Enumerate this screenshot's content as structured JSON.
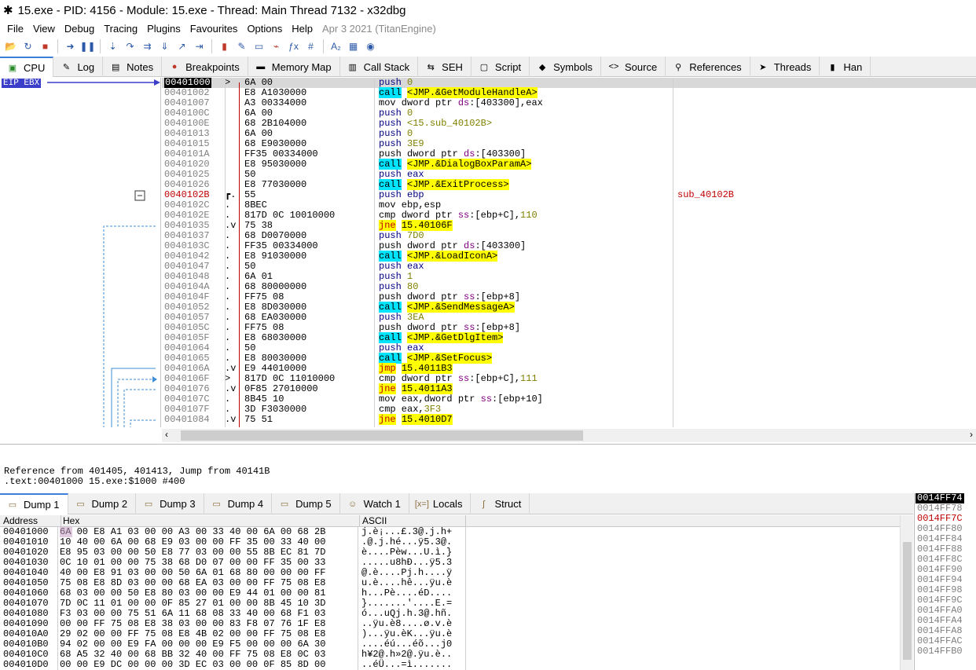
{
  "title": "15.exe - PID: 4156 - Module: 15.exe - Thread: Main Thread 7132 - x32dbg",
  "menu": [
    "File",
    "View",
    "Debug",
    "Tracing",
    "Plugins",
    "Favourites",
    "Options",
    "Help"
  ],
  "menu_date": "Apr 3 2021 (TitanEngine)",
  "toolbar_icons": [
    "open-icon",
    "restart-icon",
    "stop-icon",
    "run-icon",
    "pause-icon",
    "step-into-icon",
    "step-over-icon",
    "trace-into-icon",
    "trace-over-icon",
    "execute-till-return-icon",
    "run-to-user-code-icon",
    "script-icon",
    "comment-icon",
    "label-icon",
    "bookmark-icon",
    "function-icon",
    "hash-icon",
    "font-icon",
    "calculator-icon",
    "globe-icon"
  ],
  "tabs": [
    {
      "label": "CPU",
      "icon": "cpu-icon",
      "active": true
    },
    {
      "label": "Log",
      "icon": "log-icon"
    },
    {
      "label": "Notes",
      "icon": "notes-icon"
    },
    {
      "label": "Breakpoints",
      "icon": "breakpoint-icon"
    },
    {
      "label": "Memory Map",
      "icon": "memory-icon"
    },
    {
      "label": "Call Stack",
      "icon": "callstack-icon"
    },
    {
      "label": "SEH",
      "icon": "seh-icon"
    },
    {
      "label": "Script",
      "icon": "script-icon"
    },
    {
      "label": "Symbols",
      "icon": "symbols-icon"
    },
    {
      "label": "Source",
      "icon": "source-icon"
    },
    {
      "label": "References",
      "icon": "references-icon"
    },
    {
      "label": "Threads",
      "icon": "threads-icon"
    },
    {
      "label": "Han",
      "icon": "handles-icon"
    }
  ],
  "eip_label": "EIP EBX",
  "disasm": [
    {
      "addr": "00401000",
      "gut": ">",
      "bytes": "6A 00",
      "instr": [
        [
          "push",
          "mn"
        ],
        [
          " ",
          ""
        ],
        [
          "0",
          "num"
        ]
      ],
      "current": true
    },
    {
      "addr": "00401002",
      "gut": "",
      "bytes": "E8 A1030000",
      "instr": [
        [
          "call",
          "hl-call"
        ],
        [
          " ",
          ""
        ],
        [
          "<JMP.&GetModuleHandleA>",
          "hl-y"
        ]
      ]
    },
    {
      "addr": "00401007",
      "gut": "",
      "bytes": "A3 00334000",
      "instr": [
        [
          "mov dword ptr ",
          "mnb"
        ],
        [
          "ds",
          "seg"
        ],
        [
          ":[403300],eax",
          "mnb"
        ]
      ]
    },
    {
      "addr": "0040100C",
      "gut": "",
      "bytes": "6A 00",
      "instr": [
        [
          "push",
          "mn"
        ],
        [
          " ",
          ""
        ],
        [
          "0",
          "num"
        ]
      ]
    },
    {
      "addr": "0040100E",
      "gut": "",
      "bytes": "68 2B104000",
      "instr": [
        [
          "push",
          "mn"
        ],
        [
          " ",
          ""
        ],
        [
          "<15.sub_40102B>",
          "num"
        ]
      ]
    },
    {
      "addr": "00401013",
      "gut": "",
      "bytes": "6A 00",
      "instr": [
        [
          "push",
          "mn"
        ],
        [
          " ",
          ""
        ],
        [
          "0",
          "num"
        ]
      ]
    },
    {
      "addr": "00401015",
      "gut": "",
      "bytes": "68 E9030000",
      "instr": [
        [
          "push",
          "mn"
        ],
        [
          " ",
          ""
        ],
        [
          "3E9",
          "num"
        ]
      ]
    },
    {
      "addr": "0040101A",
      "gut": "",
      "bytes": "FF35 00334000",
      "instr": [
        [
          "push dword ptr ",
          "mnb"
        ],
        [
          "ds",
          "seg"
        ],
        [
          ":[403300]",
          "mnb"
        ]
      ]
    },
    {
      "addr": "00401020",
      "gut": "",
      "bytes": "E8 95030000",
      "instr": [
        [
          "call",
          "hl-call"
        ],
        [
          " ",
          ""
        ],
        [
          "<JMP.&DialogBoxParamA>",
          "hl-y"
        ]
      ]
    },
    {
      "addr": "00401025",
      "gut": "",
      "bytes": "50",
      "instr": [
        [
          "push eax",
          "mn"
        ]
      ]
    },
    {
      "addr": "00401026",
      "gut": "",
      "bytes": "E8 77030000",
      "instr": [
        [
          "call",
          "hl-call"
        ],
        [
          " ",
          ""
        ],
        [
          "<JMP.&ExitProcess>",
          "hl-y"
        ]
      ]
    },
    {
      "addr": "0040102B",
      "gut": "┏.",
      "bytes": "55",
      "instr": [
        [
          "push ebp",
          "mn"
        ]
      ],
      "fn": true,
      "comment": "sub_40102B"
    },
    {
      "addr": "0040102C",
      "gut": ".",
      "bytes": "8BEC",
      "instr": [
        [
          "mov ebp,esp",
          "mnb"
        ]
      ]
    },
    {
      "addr": "0040102E",
      "gut": ".",
      "bytes": "817D 0C 10010000",
      "instr": [
        [
          "cmp dword ptr ",
          "mnb"
        ],
        [
          "ss",
          "seg"
        ],
        [
          ":[ebp+C],",
          "mnb"
        ],
        [
          "110",
          "num"
        ]
      ]
    },
    {
      "addr": "00401035",
      "gut": ".v",
      "bytes": "75 38",
      "instr": [
        [
          "jne",
          "hl-jne"
        ],
        [
          " ",
          ""
        ],
        [
          "15.40106F",
          "hl-y"
        ]
      ]
    },
    {
      "addr": "00401037",
      "gut": ".",
      "bytes": "68 D0070000",
      "instr": [
        [
          "push",
          "mn"
        ],
        [
          " ",
          ""
        ],
        [
          "7D0",
          "num"
        ]
      ]
    },
    {
      "addr": "0040103C",
      "gut": ".",
      "bytes": "FF35 00334000",
      "instr": [
        [
          "push dword ptr ",
          "mnb"
        ],
        [
          "ds",
          "seg"
        ],
        [
          ":[403300]",
          "mnb"
        ]
      ]
    },
    {
      "addr": "00401042",
      "gut": ".",
      "bytes": "E8 91030000",
      "instr": [
        [
          "call",
          "hl-call"
        ],
        [
          " ",
          ""
        ],
        [
          "<JMP.&LoadIconA>",
          "hl-y"
        ]
      ]
    },
    {
      "addr": "00401047",
      "gut": ".",
      "bytes": "50",
      "instr": [
        [
          "push eax",
          "mn"
        ]
      ]
    },
    {
      "addr": "00401048",
      "gut": ".",
      "bytes": "6A 01",
      "instr": [
        [
          "push",
          "mn"
        ],
        [
          " ",
          ""
        ],
        [
          "1",
          "num"
        ]
      ]
    },
    {
      "addr": "0040104A",
      "gut": ".",
      "bytes": "68 80000000",
      "instr": [
        [
          "push",
          "mn"
        ],
        [
          " ",
          ""
        ],
        [
          "80",
          "num"
        ]
      ]
    },
    {
      "addr": "0040104F",
      "gut": ".",
      "bytes": "FF75 08",
      "instr": [
        [
          "push dword ptr ",
          "mnb"
        ],
        [
          "ss",
          "seg"
        ],
        [
          ":[ebp+8]",
          "mnb"
        ]
      ]
    },
    {
      "addr": "00401052",
      "gut": ".",
      "bytes": "E8 8D030000",
      "instr": [
        [
          "call",
          "hl-call"
        ],
        [
          " ",
          ""
        ],
        [
          "<JMP.&SendMessageA>",
          "hl-y"
        ]
      ]
    },
    {
      "addr": "00401057",
      "gut": ".",
      "bytes": "68 EA030000",
      "instr": [
        [
          "push",
          "mn"
        ],
        [
          " ",
          ""
        ],
        [
          "3EA",
          "num"
        ]
      ]
    },
    {
      "addr": "0040105C",
      "gut": ".",
      "bytes": "FF75 08",
      "instr": [
        [
          "push dword ptr ",
          "mnb"
        ],
        [
          "ss",
          "seg"
        ],
        [
          ":[ebp+8]",
          "mnb"
        ]
      ]
    },
    {
      "addr": "0040105F",
      "gut": ".",
      "bytes": "E8 68030000",
      "instr": [
        [
          "call",
          "hl-call"
        ],
        [
          " ",
          ""
        ],
        [
          "<JMP.&GetDlgItem>",
          "hl-y"
        ]
      ]
    },
    {
      "addr": "00401064",
      "gut": ".",
      "bytes": "50",
      "instr": [
        [
          "push eax",
          "mn"
        ]
      ]
    },
    {
      "addr": "00401065",
      "gut": ".",
      "bytes": "E8 80030000",
      "instr": [
        [
          "call",
          "hl-call"
        ],
        [
          " ",
          ""
        ],
        [
          "<JMP.&SetFocus>",
          "hl-y"
        ]
      ]
    },
    {
      "addr": "0040106A",
      "gut": ".v",
      "bytes": "E9 44010000",
      "instr": [
        [
          "jmp",
          "hl-jne"
        ],
        [
          " ",
          ""
        ],
        [
          "15.4011B3",
          "hl-y"
        ]
      ]
    },
    {
      "addr": "0040106F",
      "gut": ">",
      "bytes": "817D 0C 11010000",
      "instr": [
        [
          "cmp dword ptr ",
          "mnb"
        ],
        [
          "ss",
          "seg"
        ],
        [
          ":[ebp+C],",
          "mnb"
        ],
        [
          "111",
          "num"
        ]
      ]
    },
    {
      "addr": "00401076",
      "gut": ".v",
      "bytes": "0F85 27010000",
      "instr": [
        [
          "jne",
          "hl-jne"
        ],
        [
          " ",
          ""
        ],
        [
          "15.4011A3",
          "hl-y"
        ]
      ]
    },
    {
      "addr": "0040107C",
      "gut": ".",
      "bytes": "8B45 10",
      "instr": [
        [
          "mov eax,dword ptr ",
          "mnb"
        ],
        [
          "ss",
          "seg"
        ],
        [
          ":[ebp+10]",
          "mnb"
        ]
      ]
    },
    {
      "addr": "0040107F",
      "gut": ".",
      "bytes": "3D F3030000",
      "instr": [
        [
          "cmp eax,",
          "mnb"
        ],
        [
          "3F3",
          "num"
        ]
      ]
    },
    {
      "addr": "00401084",
      "gut": ".v",
      "bytes": "75 51",
      "instr": [
        [
          "jne",
          "hl-jne"
        ],
        [
          " ",
          ""
        ],
        [
          "15.4010D7",
          "hl-y"
        ]
      ]
    }
  ],
  "info_lines": [
    "Reference from 401405, 401413, Jump from 40141B",
    ".text:00401000 15.exe:$1000 #400"
  ],
  "dump_tabs": [
    {
      "label": "Dump 1",
      "icon": "dump-icon",
      "active": true
    },
    {
      "label": "Dump 2",
      "icon": "dump-icon"
    },
    {
      "label": "Dump 3",
      "icon": "dump-icon"
    },
    {
      "label": "Dump 4",
      "icon": "dump-icon"
    },
    {
      "label": "Dump 5",
      "icon": "dump-icon"
    },
    {
      "label": "Watch 1",
      "icon": "watch-icon"
    },
    {
      "label": "Locals",
      "icon": "locals-icon"
    },
    {
      "label": "Struct",
      "icon": "struct-icon"
    }
  ],
  "dump_headers": {
    "address": "Address",
    "hex": "Hex",
    "ascii": "ASCII"
  },
  "dump_rows": [
    {
      "addr": "00401000",
      "hex": "6A 00 E8 A1 03 00 00 A3 00 33 40 00 6A 00 68 2B",
      "ascii": "j.è¡...£.3@.j.h+"
    },
    {
      "addr": "00401010",
      "hex": "10 40 00 6A 00 68 E9 03 00 00 FF 35 00 33 40 00",
      "ascii": ".@.j.hé...ÿ5.3@."
    },
    {
      "addr": "00401020",
      "hex": "E8 95 03 00 00 50 E8 77 03 00 00 55 8B EC 81 7D",
      "ascii": "è....Pèw...U.ì.}"
    },
    {
      "addr": "00401030",
      "hex": "0C 10 01 00 00 75 38 68 D0 07 00 00 FF 35 00 33",
      "ascii": ".....u8hÐ...ÿ5.3"
    },
    {
      "addr": "00401040",
      "hex": "40 00 E8 91 03 00 00 50 6A 01 68 80 00 00 00 FF",
      "ascii": "@.è....Pj.h....ÿ"
    },
    {
      "addr": "00401050",
      "hex": "75 08 E8 8D 03 00 00 68 EA 03 00 00 FF 75 08 E8",
      "ascii": "u.è....hê...ÿu.è"
    },
    {
      "addr": "00401060",
      "hex": "68 03 00 00 50 E8 80 03 00 00 E9 44 01 00 00 81",
      "ascii": "h...Pè....éD...."
    },
    {
      "addr": "00401070",
      "hex": "7D 0C 11 01 00 00 0F 85 27 01 00 00 8B 45 10 3D",
      "ascii": "}.......'....E.="
    },
    {
      "addr": "00401080",
      "hex": "F3 03 00 00 75 51 6A 11 68 08 33 40 00 68 F1 03",
      "ascii": "ó...uQj.h.3@.hñ."
    },
    {
      "addr": "00401090",
      "hex": "00 00 FF 75 08 E8 38 03 00 00 83 F8 07 76 1F E8",
      "ascii": "..ÿu.è8....ø.v.è"
    },
    {
      "addr": "004010A0",
      "hex": "29 02 00 00 FF 75 08 E8 4B 02 00 00 FF 75 08 E8",
      "ascii": ")...ÿu.èK...ÿu.è"
    },
    {
      "addr": "004010B0",
      "hex": "94 02 00 00 E9 FA 00 00 00 E9 F5 00 00 00 6A 30",
      "ascii": "....éú...éõ...j0"
    },
    {
      "addr": "004010C0",
      "hex": "68 A5 32 40 00 68 BB 32 40 00 FF 75 08 E8 0C 03",
      "ascii": "h¥2@.h»2@.ÿu.è.."
    },
    {
      "addr": "004010D0",
      "hex": "00 00 E9 DC 00 00 00 3D EC 03 00 00 0F 85 8D 00",
      "ascii": "..éÜ...=ì......."
    }
  ],
  "stack": [
    "0014FF74",
    "0014FF78",
    "0014FF7C",
    "0014FF80",
    "0014FF84",
    "0014FF88",
    "0014FF8C",
    "0014FF90",
    "0014FF94",
    "0014FF98",
    "0014FF9C",
    "0014FFA0",
    "0014FFA4",
    "0014FFA8",
    "0014FFAC",
    "0014FFB0"
  ],
  "colors": {
    "accent": "#3a3ec8",
    "call_highlight": "#00e5ff",
    "jump_highlight": "#ffff00",
    "function_label": "#c00000"
  }
}
